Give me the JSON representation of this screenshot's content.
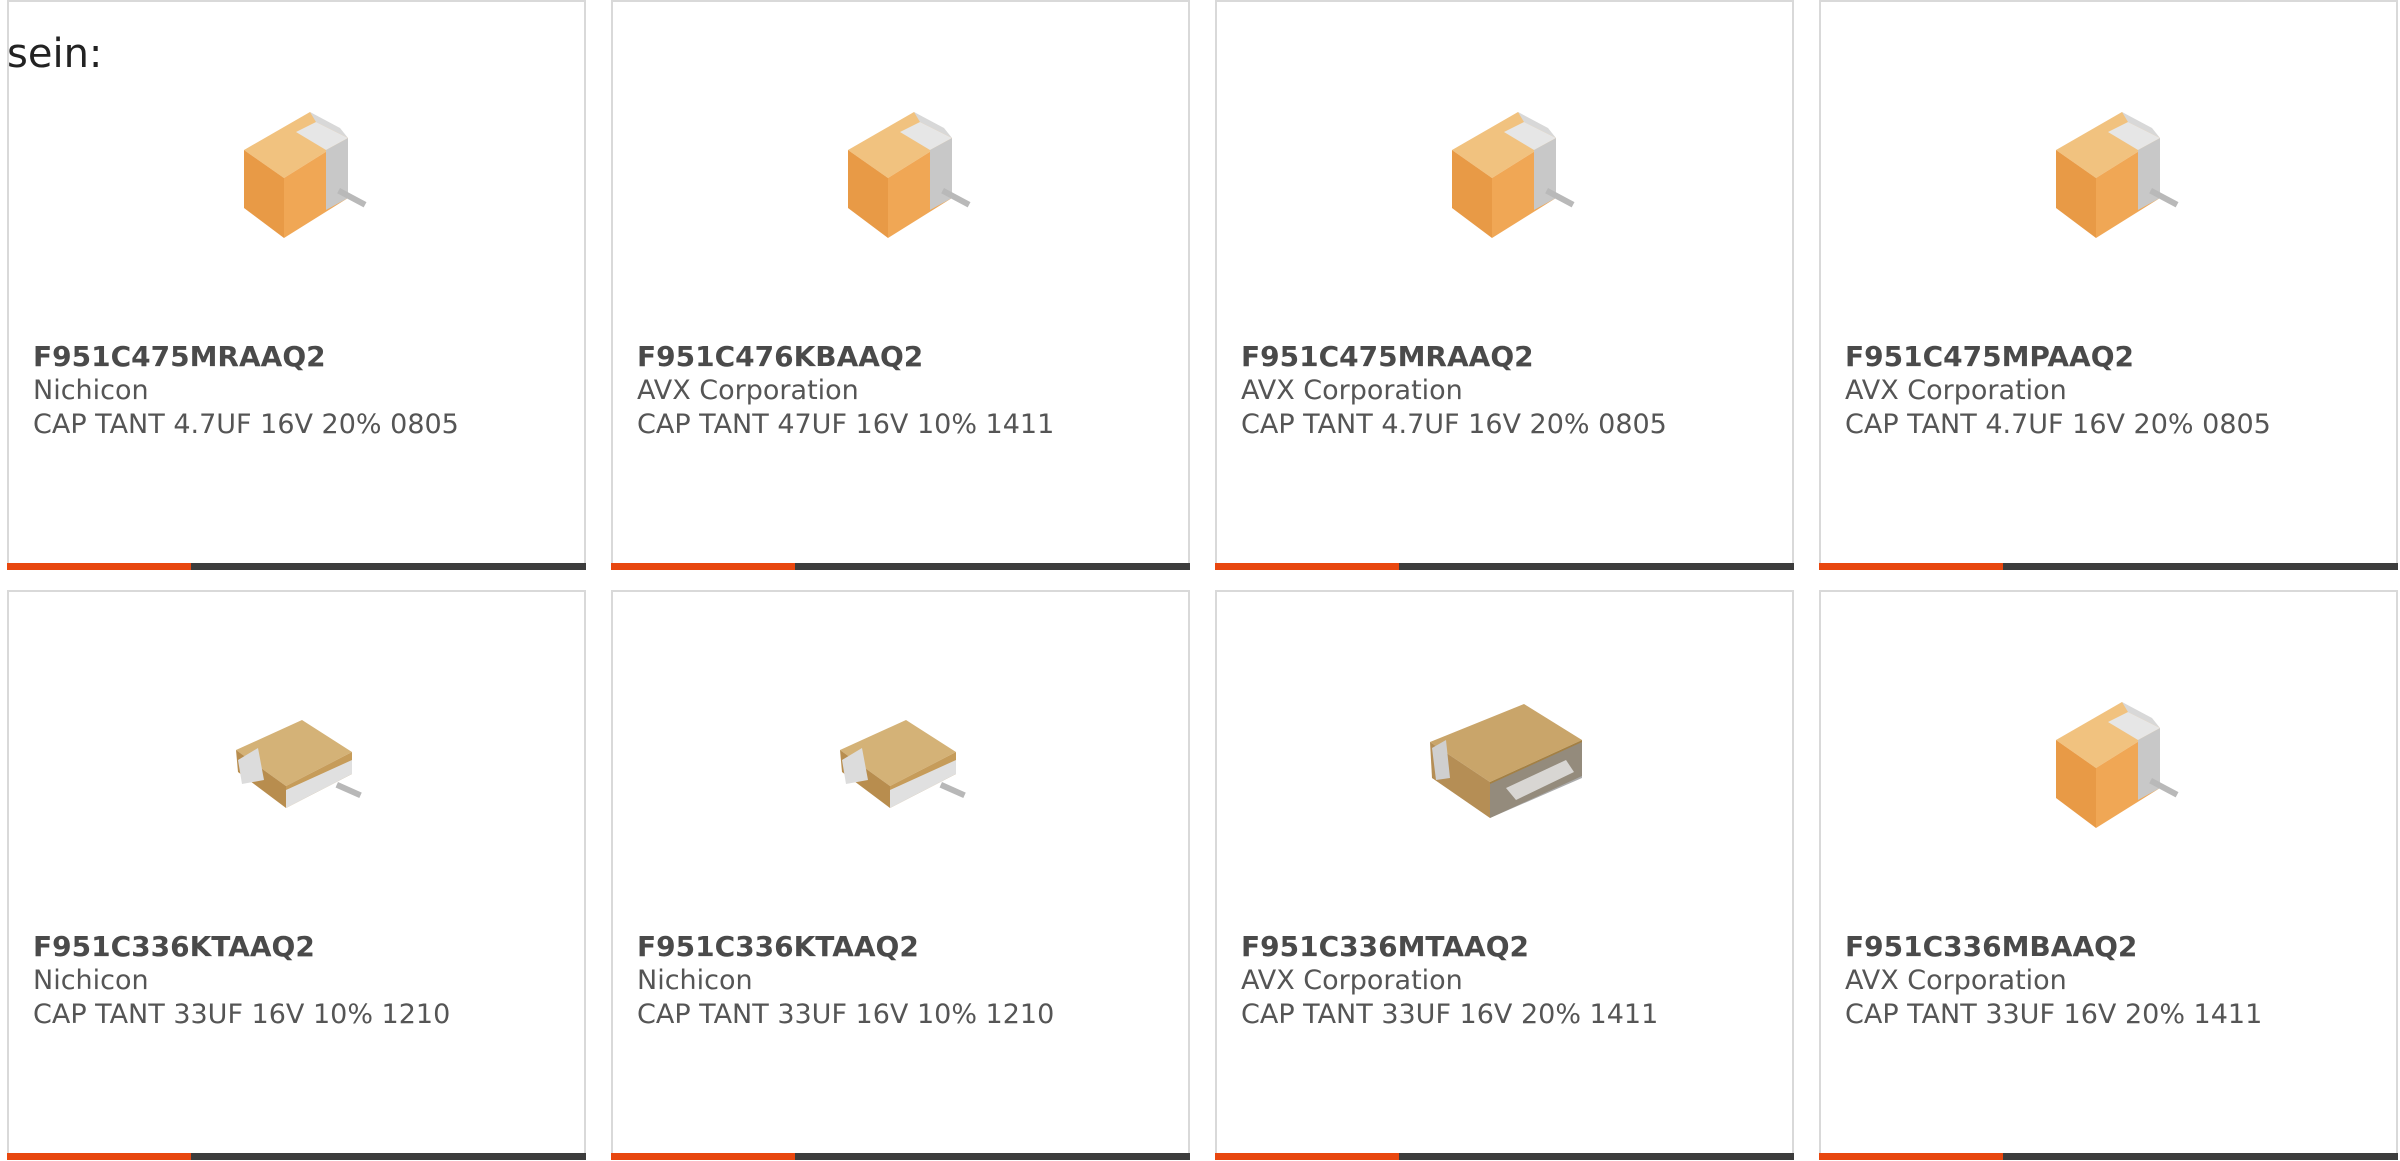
{
  "intro_text": "sein:",
  "colors": {
    "accent": "#e8470f",
    "bar_dark": "#3c3c3c",
    "card_border": "#d9d9d9"
  },
  "cards": [
    {
      "part_number": "F951C475MRAAQ2",
      "manufacturer": "Nichicon",
      "description": "CAP TANT 4.7UF 16V 20% 0805",
      "image_icon": "orange-block-capacitor-icon"
    },
    {
      "part_number": "F951C476KBAAQ2",
      "manufacturer": "AVX Corporation",
      "description": "CAP TANT 47UF 16V 10% 1411",
      "image_icon": "orange-block-capacitor-icon"
    },
    {
      "part_number": "F951C475MRAAQ2",
      "manufacturer": "AVX Corporation",
      "description": "CAP TANT 4.7UF 16V 20% 0805",
      "image_icon": "orange-block-capacitor-icon"
    },
    {
      "part_number": "F951C475MPAAQ2",
      "manufacturer": "AVX Corporation",
      "description": "CAP TANT 4.7UF 16V 20% 0805",
      "image_icon": "orange-block-capacitor-icon"
    },
    {
      "part_number": "F951C336KTAAQ2",
      "manufacturer": "Nichicon",
      "description": "CAP TANT 33UF 16V 10% 1210",
      "image_icon": "flat-tan-capacitor-icon"
    },
    {
      "part_number": "F951C336KTAAQ2",
      "manufacturer": "Nichicon",
      "description": "CAP TANT 33UF 16V 10% 1210",
      "image_icon": "flat-tan-capacitor-icon"
    },
    {
      "part_number": "F951C336MTAAQ2",
      "manufacturer": "AVX Corporation",
      "description": "CAP TANT 33UF 16V 20% 1411",
      "image_icon": "wrapped-tan-capacitor-icon"
    },
    {
      "part_number": "F951C336MBAAQ2",
      "manufacturer": "AVX Corporation",
      "description": "CAP TANT 33UF 16V 20% 1411",
      "image_icon": "orange-block-capacitor-icon"
    }
  ]
}
